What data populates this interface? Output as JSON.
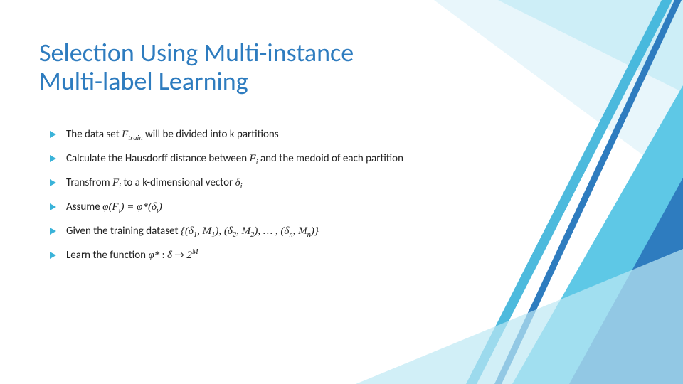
{
  "title": "Selection Using Multi-instance Multi-label Learning",
  "bullets": [
    {
      "lead": "The data set ",
      "math1": "F<sub>train</sub>",
      "mid1": " will be divided into k partitions",
      "math2": "",
      "mid2": "",
      "math3": "",
      "tail": ""
    },
    {
      "lead": "Calculate the Hausdorff distance between ",
      "math1": "F<sub>i</sub>",
      "mid1": " and the medoid of each partition",
      "math2": "",
      "mid2": "",
      "math3": "",
      "tail": ""
    },
    {
      "lead": "Transfrom ",
      "math1": "F<sub>i</sub>",
      "mid1": " to a k-dimensional vector ",
      "math2": "δ<sub>i</sub>",
      "mid2": "",
      "math3": "",
      "tail": ""
    },
    {
      "lead": "Assume ",
      "math1": "φ(F<sub>i</sub>) = φ*(δ<sub>i</sub>)",
      "mid1": "",
      "math2": "",
      "mid2": "",
      "math3": "",
      "tail": ""
    },
    {
      "lead": "Given the training dataset ",
      "math1": "{(δ<sub>1</sub>, M<sub>1</sub>), (δ<sub>2</sub>, M<sub>2</sub>), … , (δ<sub>n</sub>, M<sub>n</sub>)}",
      "mid1": "",
      "math2": "",
      "mid2": "",
      "math3": "",
      "tail": ""
    },
    {
      "lead": "Learn the function ",
      "math1": "φ*",
      "mid1": " : ",
      "math2": "δ",
      "mid2": " → ",
      "math3": "2<sup>M</sup>",
      "tail": ""
    }
  ]
}
